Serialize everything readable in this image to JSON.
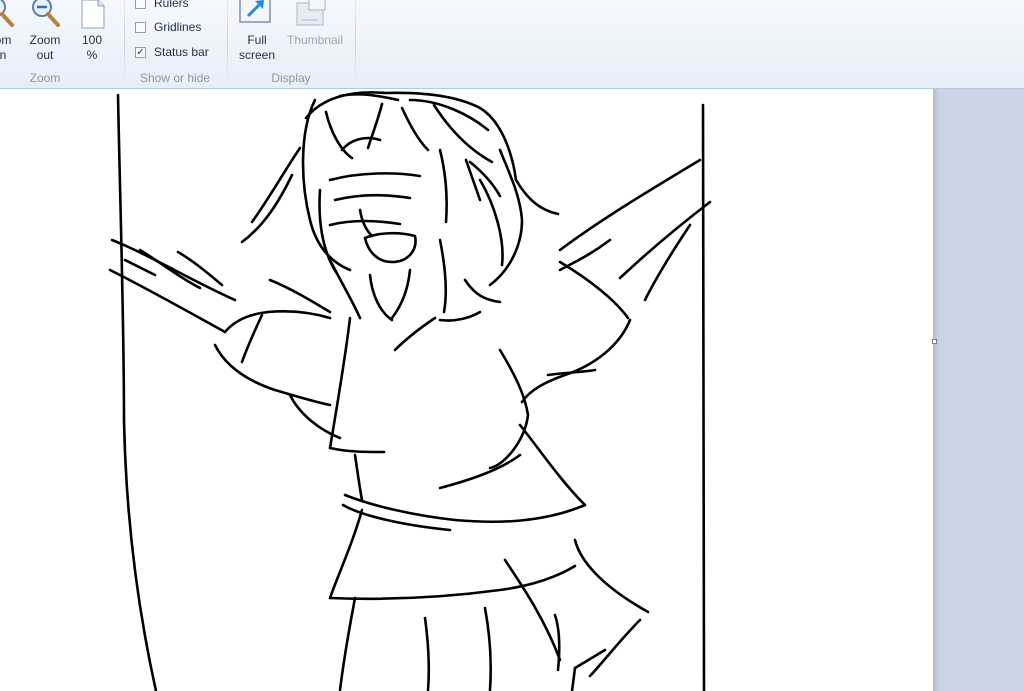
{
  "ribbon": {
    "zoom_group": {
      "label": "Zoom",
      "zoom_in_label": "om\nn",
      "zoom_out_label": "Zoom\nout",
      "hundred_label": "100\n%"
    },
    "show_hide_group": {
      "label": "Show or hide",
      "rulers": {
        "label": "Rulers",
        "checked": false
      },
      "gridlines": {
        "label": "Gridlines",
        "checked": false
      },
      "status_bar": {
        "label": "Status bar",
        "checked": true
      }
    },
    "display_group": {
      "label": "Display",
      "full_screen_label": "Full\nscreen",
      "thumbnail_label": "Thumbnail"
    }
  },
  "canvas": {
    "background": "#ffffff",
    "workspace_color": "#c9d5e6",
    "stroke_color": "#000000"
  }
}
